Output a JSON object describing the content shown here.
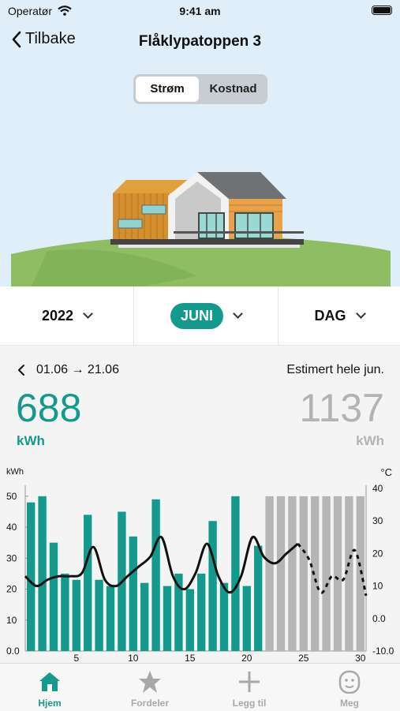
{
  "status_bar": {
    "carrier": "Operatør",
    "time": "9:41 am"
  },
  "nav": {
    "back_label": "Tilbake",
    "title": "Flåklypatoppen 3"
  },
  "segment": {
    "options": [
      "Strøm",
      "Kostnad"
    ],
    "selected": "Strøm"
  },
  "selectors": {
    "year": "2022",
    "month": "JUNI",
    "period": "DAG"
  },
  "summary": {
    "range": "01.06 → 21.06",
    "estimate_label": "Estimert hele jun.",
    "actual_value": "688",
    "actual_unit": "kWh",
    "estimate_value": "1137",
    "estimate_unit": "kWh"
  },
  "colors": {
    "accent": "#149a8c",
    "estimate_bar": "#b5b5b5",
    "temperature_line": "#111111"
  },
  "chart_data": {
    "type": "bar",
    "ylabel_left": "kWh",
    "ylabel_right": "°C",
    "ylim": [
      0,
      52
    ],
    "y2lim": [
      -10,
      40
    ],
    "left_ticks": [
      "0.0",
      "10",
      "20",
      "30",
      "40",
      "50"
    ],
    "right_ticks": [
      "-10.0",
      "0.0",
      "10",
      "20",
      "30",
      "40"
    ],
    "x_ticks": [
      "5",
      "10",
      "15",
      "20",
      "25",
      "30"
    ],
    "days": [
      1,
      2,
      3,
      4,
      5,
      6,
      7,
      8,
      9,
      10,
      11,
      12,
      13,
      14,
      15,
      16,
      17,
      18,
      19,
      20,
      21,
      22,
      23,
      24,
      25,
      26,
      27,
      28,
      29,
      30
    ],
    "consumption_kwh": [
      48,
      50,
      35,
      25,
      23,
      44,
      23,
      21,
      45,
      37,
      22,
      49,
      21,
      25,
      20,
      25,
      42,
      22,
      50,
      21,
      34
    ],
    "estimated_kwh": [
      50,
      50,
      50,
      50,
      50,
      50,
      50,
      50,
      50
    ],
    "temperature_c": [
      13,
      10,
      12,
      13,
      13,
      14,
      22,
      12,
      10,
      13,
      16,
      19,
      25,
      13,
      9,
      14,
      23,
      13,
      8,
      13,
      25,
      19,
      17,
      20,
      23,
      18,
      8,
      13,
      12,
      21,
      7
    ]
  },
  "tabs": [
    {
      "label": "Hjem",
      "icon": "home-icon",
      "active": true
    },
    {
      "label": "Fordeler",
      "icon": "star-icon",
      "active": false
    },
    {
      "label": "Legg til",
      "icon": "plus-icon",
      "active": false
    },
    {
      "label": "Meg",
      "icon": "face-icon",
      "active": false
    }
  ]
}
